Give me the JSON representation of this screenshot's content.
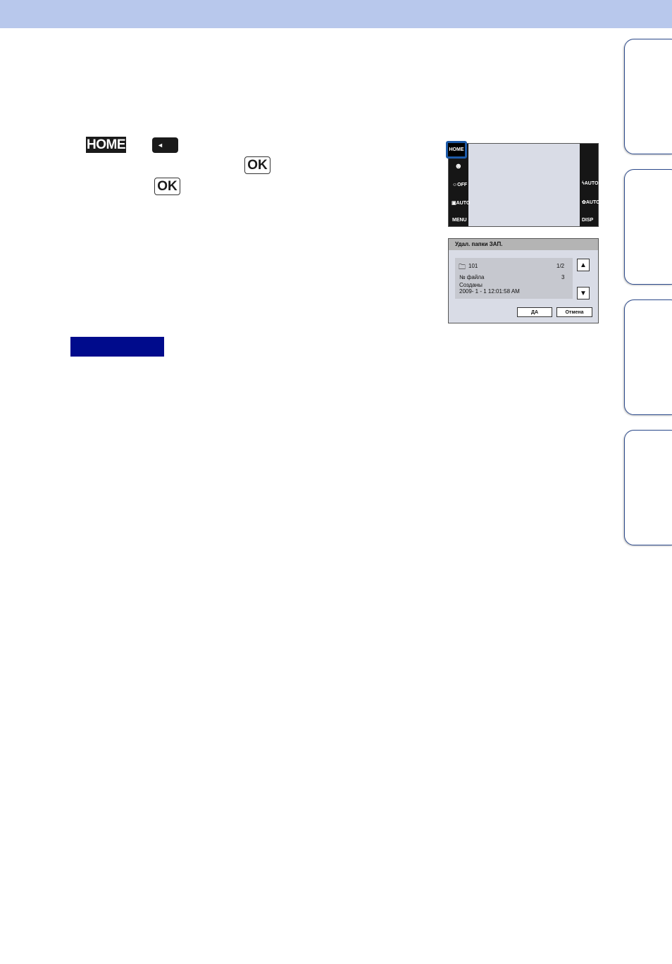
{
  "keys": {
    "home": "HOME",
    "left_arrow": "◄",
    "ok": "OK"
  },
  "screen1": {
    "home_label": "HOME",
    "face_icon": "☻",
    "smile_off": "OFF",
    "scene_auto": "AUTO",
    "menu": "MENU",
    "flash_auto": "AUTO",
    "macro_auto": "AUTO",
    "disp": "DISP"
  },
  "screen2": {
    "title": "Удал. папки ЗАП.",
    "folder_name": "101",
    "page": "1/2",
    "file_count_label": "№ файла",
    "file_count": "3",
    "created_label": "Созданы",
    "created_value": "2009- 1 - 1 12:01:58 AM",
    "yes_button": "ДА",
    "cancel_button": "Отмена"
  },
  "colors": {
    "top_band": "#b8c8ec",
    "note_bar": "#000b8c",
    "highlight": "#1d5aa8"
  }
}
